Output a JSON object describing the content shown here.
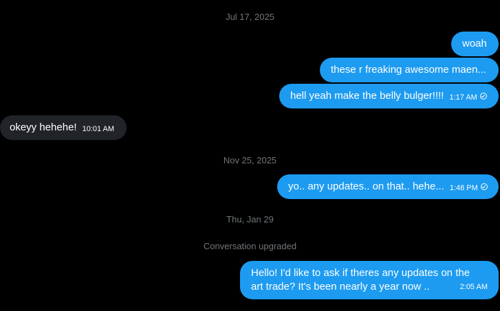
{
  "separators": {
    "date1": "Jul 17, 2025",
    "date2": "Nov 25, 2025",
    "date3": "Thu, Jan 29",
    "system": "Conversation upgraded"
  },
  "messages": [
    {
      "text": "woah",
      "side": "sent"
    },
    {
      "text": "these r freaking awesome maen...",
      "side": "sent"
    },
    {
      "text": "hell yeah make the belly bulger!!!!",
      "time": "1:17 AM",
      "side": "sent",
      "status": "sent-check-icon"
    },
    {
      "text": "okeyy hehehe!",
      "time": "10:01 AM",
      "side": "received"
    },
    {
      "text": "yo.. any updates.. on that.. hehe...",
      "time": "1:48 PM",
      "side": "sent",
      "status": "sent-check-icon"
    },
    {
      "line1": "Hello! I'd like to ask if theres any updates on the",
      "line2": "art trade? It's been nearly a year now ..",
      "time": "2:05 AM",
      "side": "sent"
    }
  ],
  "colors": {
    "background": "#000000",
    "sent_bubble": "#1d9bf0",
    "received_bubble": "#202327",
    "separator_text": "#71767b"
  }
}
